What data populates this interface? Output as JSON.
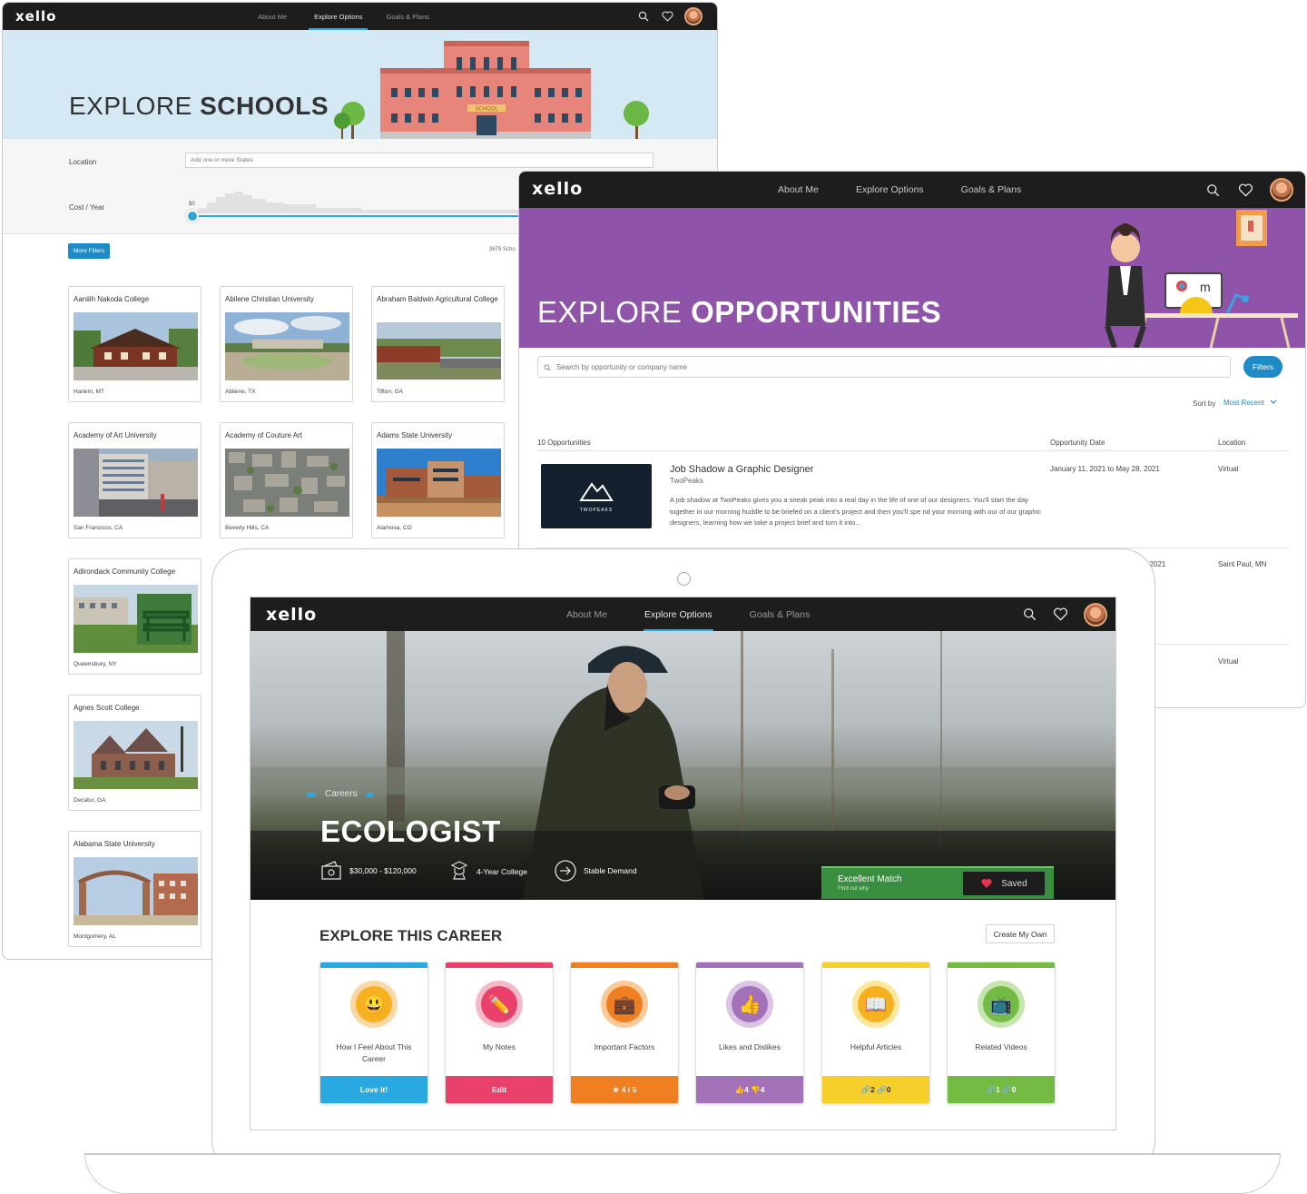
{
  "nav": {
    "logo": "xello",
    "links": [
      "About Me",
      "Explore Options",
      "Goals & Plans"
    ]
  },
  "schools": {
    "title_light": "EXPLORE ",
    "title_bold": "SCHOOLS",
    "location_label": "Location",
    "location_placeholder": "Add one or more States",
    "cost_label": "Cost / Year",
    "cost_min": "$0",
    "more_filters": "More Filters",
    "count": "3679 Scho",
    "cards": [
      {
        "name": "Aaniiih Nakoda College",
        "location": "Harlem, MT"
      },
      {
        "name": "Abilene Christian University",
        "location": "Abilene, TX"
      },
      {
        "name": "Abraham Baldwin Agricultural College",
        "location": "Tifton, GA"
      },
      {
        "name": "Academy of Art University",
        "location": "San Francisco, CA"
      },
      {
        "name": "Academy of Couture Art",
        "location": "Beverly Hills, CA"
      },
      {
        "name": "Adams State University",
        "location": "Alamosa, CO"
      },
      {
        "name": "Adirondack Community College",
        "location": "Queensbury, NY"
      },
      {
        "name": "Agnes Scott College",
        "location": "Decatur, GA"
      },
      {
        "name": "Alabama State University",
        "location": "Montgomery, AL"
      }
    ],
    "building_sign": "SCHOOL"
  },
  "opps": {
    "title_light": "EXPLORE ",
    "title_bold": "OPPORTUNITIES",
    "search_placeholder": "Search by opportunity or company name",
    "filters_button": "Filters",
    "sort_label": "Sort by",
    "sort_value": "Most Recent",
    "count": "10 Opportunities",
    "col_date": "Opportunity Date",
    "col_location": "Location",
    "rows": [
      {
        "title": "Job Shadow a Graphic Designer",
        "company": "TwoPeaks",
        "logo_text": "TWOPEAKS",
        "date": "January 11, 2021 to May 28, 2021",
        "location": "Virtual",
        "description": "A job shadow at TwoPeaks gives you a sneak peak into a real day in the life of one of our designers. You'll start the day together in our morning huddle to be briefed on a client's project and then you'll spe nd your morning with our of our graphic designers, learning how we take a project brief and turn it into..."
      },
      {
        "date_partial": ", 2021",
        "location": "Saint Paul, MN"
      },
      {
        "location": "Virtual"
      }
    ]
  },
  "career": {
    "category": "Careers",
    "title": "ECOLOGIST",
    "salary": "$30,000 - $120,000",
    "education": "4-Year College",
    "demand": "Stable Demand",
    "match": "Excellent Match",
    "match_sub": "Find out why",
    "saved": "Saved",
    "section_title": "EXPLORE THIS CAREER",
    "create_own": "Create My Own",
    "cards": [
      {
        "title": "How I Feel About This Career",
        "button": "Love it!",
        "color": "#29a9e0",
        "icon": "smiley-icon"
      },
      {
        "title": "My Notes",
        "button": "Edit",
        "color": "#e9416b",
        "icon": "pencil-icon"
      },
      {
        "title": "Important Factors",
        "button": "★ 4 / 5",
        "color": "#f07f22",
        "icon": "briefcase-icon"
      },
      {
        "title": "Likes and Dislikes",
        "button": "👍4 👎4",
        "color": "#a371b7",
        "icon": "thumbs-icon"
      },
      {
        "title": "Helpful Articles",
        "button": "🔗2 🔗0",
        "color": "#f7cf2b",
        "icon": "book-icon"
      },
      {
        "title": "Related Videos",
        "button": "🔗1 🔗0",
        "color": "#73bb43",
        "icon": "tv-icon"
      }
    ]
  }
}
